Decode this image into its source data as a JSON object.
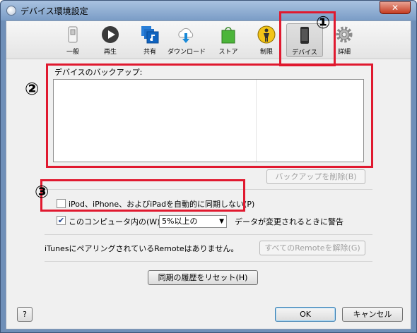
{
  "window": {
    "title": "デバイス環境設定",
    "close_label": "✕"
  },
  "toolbar": {
    "items": [
      {
        "label": "一般",
        "icon": "switch-icon"
      },
      {
        "label": "再生",
        "icon": "play-icon"
      },
      {
        "label": "共有",
        "icon": "music-share-icon"
      },
      {
        "label": "ダウンロード",
        "icon": "cloud-download-icon"
      },
      {
        "label": "ストア",
        "icon": "store-bag-icon"
      },
      {
        "label": "制限",
        "icon": "parental-restriction-icon"
      },
      {
        "label": "デバイス",
        "icon": "device-icon",
        "selected": true
      },
      {
        "label": "詳細",
        "icon": "gear-icon"
      }
    ]
  },
  "annotations": {
    "one": "①",
    "two": "②",
    "three": "③",
    "color": "#e0192f"
  },
  "backup": {
    "label": "デバイスのバックアップ:",
    "delete_button": "バックアップを削除(B)"
  },
  "sync": {
    "prevent_auto_sync": "iPod、iPhone、およびiPadを自動的に同期しない(P)",
    "prevent_auto_sync_checked": false,
    "warn_prefix": "このコンピュータ内の(W)",
    "warn_checked": true,
    "warn_select_value": "5%以上の",
    "warn_suffix": "データが変更されるときに警告"
  },
  "remote": {
    "status_text": "iTunesにペアリングされているRemoteはありません。",
    "unpair_button": "すべてのRemoteを解除(G)"
  },
  "reset_button": "同期の履歴をリセット(H)",
  "footer": {
    "help_label": "?",
    "ok_label": "OK",
    "cancel_label": "キャンセル"
  }
}
